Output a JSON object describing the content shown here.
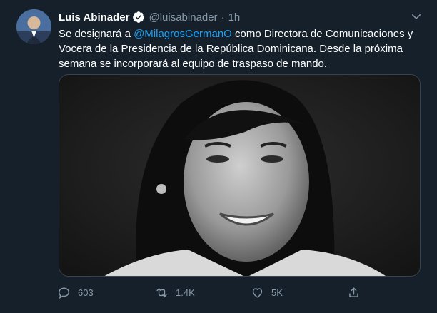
{
  "tweet": {
    "author_name": "Luis Abinader",
    "handle": "@luisabinader",
    "separator": "·",
    "time": "1h",
    "text_before": "Se designará a ",
    "mention": "@MilagrosGermanO",
    "text_after": " como Directora de Comunicaciones y Vocera de la Presidencia de la República Dominicana. Desde la próxima semana se incorporará al equipo de traspaso de mando."
  },
  "actions": {
    "reply_count": "603",
    "retweet_count": "1.4K",
    "like_count": "5K"
  },
  "colors": {
    "background": "#15202b",
    "accent": "#1da1f2",
    "muted": "#8899a6",
    "text": "#ffffff"
  },
  "icons": [
    "avatar",
    "verified-badge-icon",
    "chevron-down-icon",
    "reply-icon",
    "retweet-icon",
    "like-icon",
    "share-icon"
  ]
}
